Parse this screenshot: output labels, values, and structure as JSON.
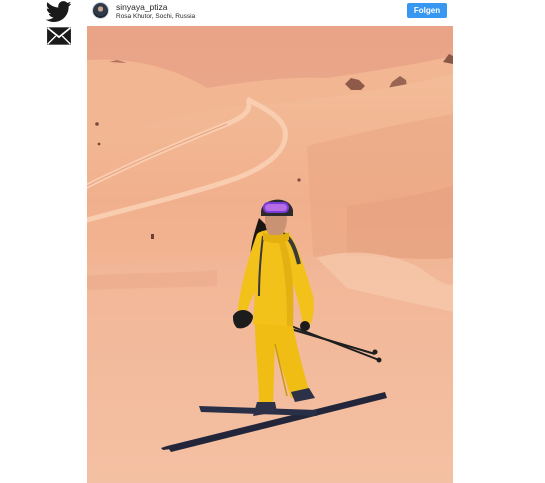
{
  "share": {
    "twitter_icon": "twitter-bird-icon",
    "mail_icon": "envelope-icon"
  },
  "post": {
    "username": "sinyaya_ptiza",
    "location": "Rosa Khutor, Sochi, Russia",
    "follow_label": "Folgen"
  },
  "colors": {
    "follow_button": "#3897f0",
    "snow_orange": "#f0b08a",
    "jacket_yellow": "#f2c21a",
    "icon_dark": "#1a1a1a"
  }
}
